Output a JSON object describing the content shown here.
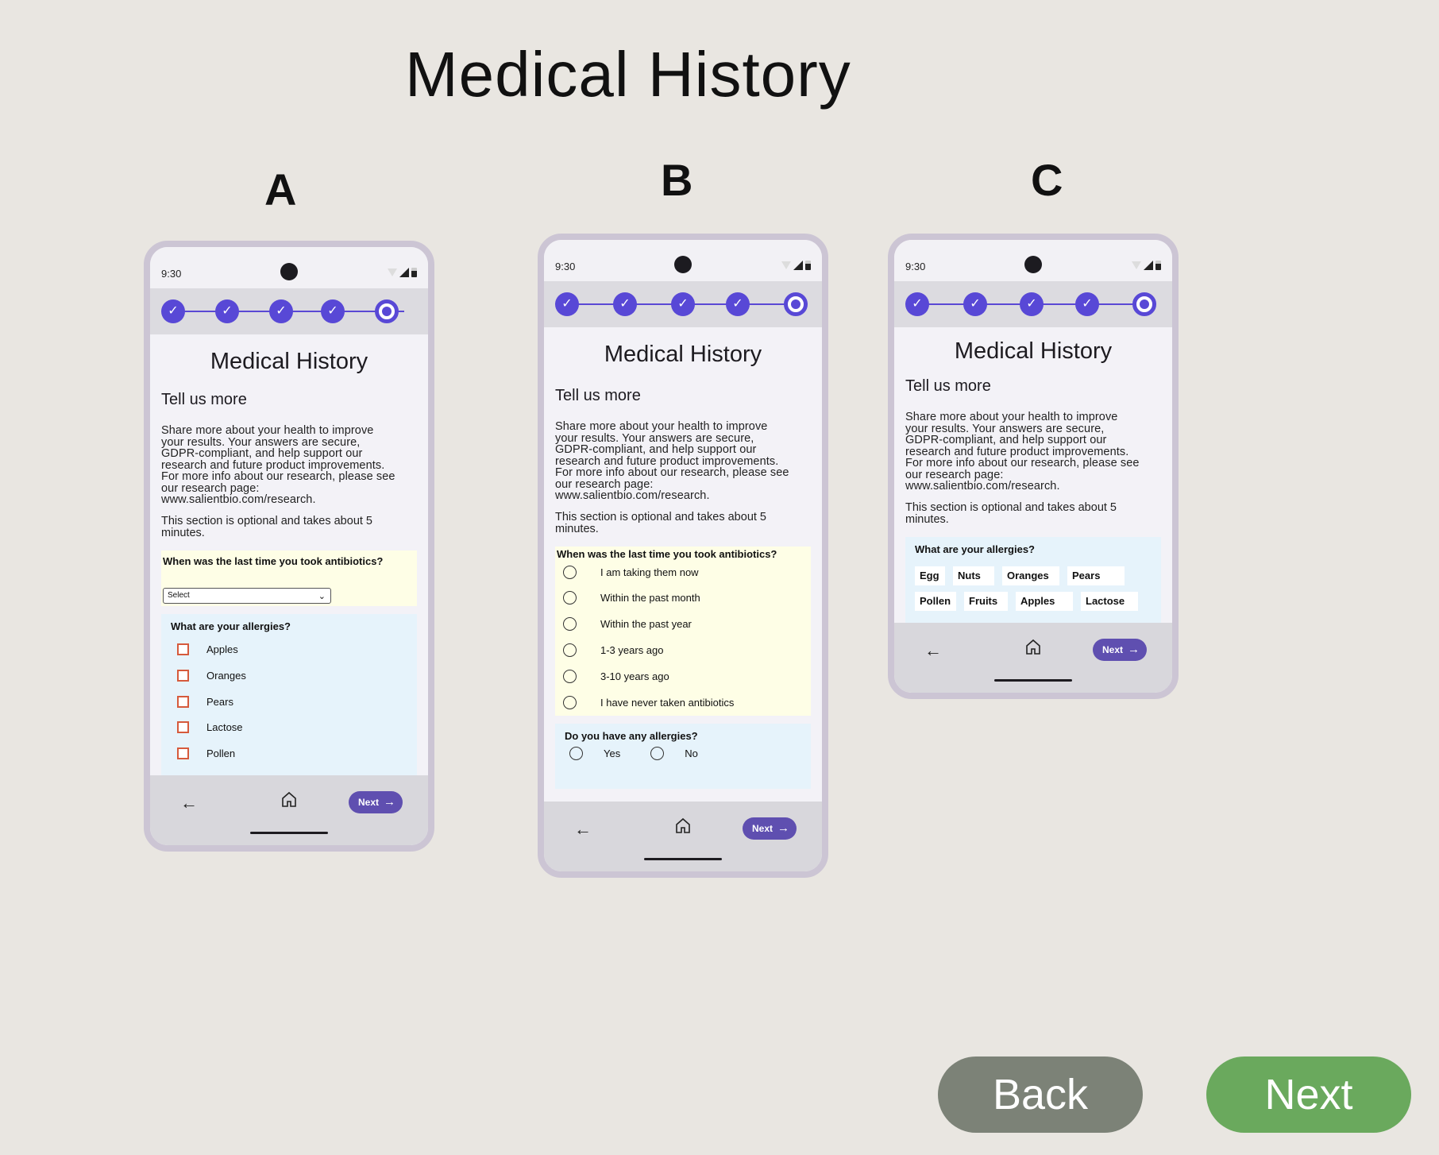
{
  "page_title": "Medical History",
  "variants": [
    {
      "label": "A"
    },
    {
      "label": "B"
    },
    {
      "label": "C"
    }
  ],
  "phone": {
    "time": "9:30",
    "screen_title": "Medical History",
    "section_heading": "Tell us more",
    "intro_lines": [
      "Share more about your health to improve",
      "your results. Your answers are secure,",
      "GDPR-compliant, and help support our",
      "research and future product improvements.",
      "For more info about our research, please see",
      "our research page:",
      "www.salientbio.com/research."
    ],
    "optional_lines": [
      "This section is optional and takes about 5",
      "minutes."
    ],
    "steps_check": "✓",
    "nav_next": "Next",
    "nav_back_glyph": "←",
    "nav_next_glyph": "→"
  },
  "variant_a": {
    "antibiotics_question": "When was the last time you took antibiotics?",
    "select_value": "Select",
    "allergies_question": "What are your allergies?",
    "allergy_options": [
      "Apples",
      "Oranges",
      "Pears",
      "Lactose",
      "Pollen"
    ]
  },
  "variant_b": {
    "antibiotics_question": "When was the last time you took antibiotics?",
    "antibiotics_options": [
      "I am taking them now",
      "Within the past month",
      "Within the past year",
      "1-3 years ago",
      "3-10 years ago",
      "I have never taken antibiotics"
    ],
    "allergy_question": "Do you have any allergies?",
    "yes": "Yes",
    "no": "No"
  },
  "variant_c": {
    "allergies_question": "What are your allergies?",
    "chips": [
      "Egg",
      "Nuts",
      "Oranges",
      "Pears",
      "Pollen",
      "Fruits",
      "Apples",
      "Lactose"
    ]
  },
  "buttons": {
    "back": "Back",
    "next": "Next"
  },
  "colors": {
    "background": "#e9e6e1",
    "stepper_accent": "#5848d6",
    "nav_next": "#5f4fb0",
    "big_back": "#7c8277",
    "big_next": "#6aa95d",
    "checkbox_border": "#d65a3c"
  }
}
